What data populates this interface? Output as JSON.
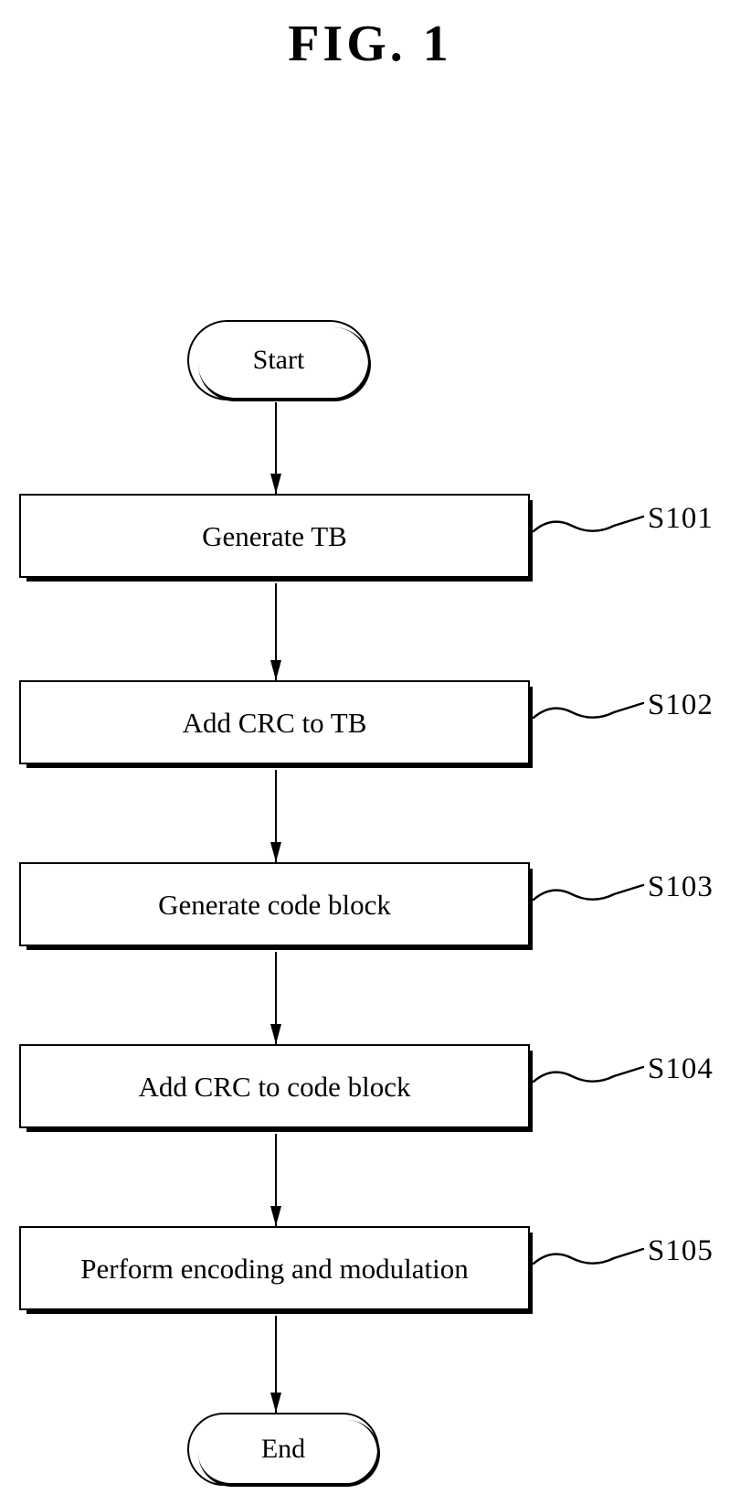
{
  "figure": {
    "title": "FIG. 1",
    "kind": "flowchart"
  },
  "chart_data": {
    "type": "diagram",
    "title": "FIG. 1",
    "orientation": "top-to-bottom",
    "node_count": 7,
    "nodes": [
      {
        "id": "start",
        "shape": "terminator",
        "label": "Start",
        "ref": ""
      },
      {
        "id": "s101",
        "shape": "process",
        "label": "Generate TB",
        "ref": "S101"
      },
      {
        "id": "s102",
        "shape": "process",
        "label": "Add CRC to TB",
        "ref": "S102"
      },
      {
        "id": "s103",
        "shape": "process",
        "label": "Generate code block",
        "ref": "S103"
      },
      {
        "id": "s104",
        "shape": "process",
        "label": "Add CRC to code block",
        "ref": "S104"
      },
      {
        "id": "s105",
        "shape": "process",
        "label": "Perform encoding and modulation",
        "ref": "S105"
      },
      {
        "id": "end",
        "shape": "terminator",
        "label": "End",
        "ref": ""
      }
    ],
    "edges": [
      {
        "from": "start",
        "to": "s101",
        "arrow": "down"
      },
      {
        "from": "s101",
        "to": "s102",
        "arrow": "down"
      },
      {
        "from": "s102",
        "to": "s103",
        "arrow": "down"
      },
      {
        "from": "s103",
        "to": "s104",
        "arrow": "down"
      },
      {
        "from": "s104",
        "to": "s105",
        "arrow": "down"
      },
      {
        "from": "s105",
        "to": "end",
        "arrow": "down"
      }
    ]
  },
  "nodes": {
    "start": {
      "label": "Start"
    },
    "step1": {
      "label": "Generate TB",
      "ref": "S101"
    },
    "step2": {
      "label": "Add CRC to TB",
      "ref": "S102"
    },
    "step3": {
      "label": "Generate code block",
      "ref": "S103"
    },
    "step4": {
      "label": "Add CRC to code block",
      "ref": "S104"
    },
    "step5": {
      "label": "Perform encoding and modulation",
      "ref": "S105"
    },
    "end": {
      "label": "End"
    }
  },
  "colors": {
    "ink": "#000000",
    "paper": "#ffffff"
  }
}
